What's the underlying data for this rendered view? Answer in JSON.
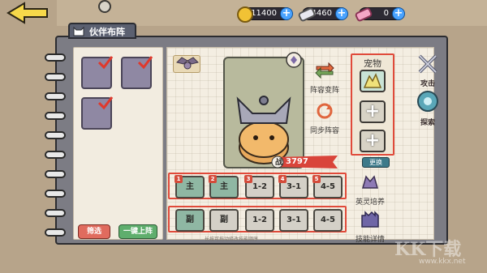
{
  "header": {
    "currencies": [
      {
        "icon": "gold-coin-icon",
        "value": "11400"
      },
      {
        "icon": "ticket-icon",
        "value": "34460"
      },
      {
        "icon": "pink-ticket-icon",
        "value": "0"
      }
    ]
  },
  "panel": {
    "title": "伙伴布阵"
  },
  "roster": {
    "filter_label": "筛选",
    "auto_label": "一键上阵"
  },
  "character": {
    "power_label": "战",
    "power_value": "3797"
  },
  "actions": {
    "formation_change": "阵容变阵",
    "sync_formation": "同步阵容",
    "hero_cultivate": "英灵培养",
    "skill_detail": "技能详情",
    "replace": "更换"
  },
  "formation": {
    "main_row": [
      {
        "num": "1",
        "label": "主",
        "filled": true
      },
      {
        "num": "2",
        "label": "主",
        "filled": true
      },
      {
        "num": "3",
        "label": "1-2",
        "filled": false
      },
      {
        "num": "4",
        "label": "3-1",
        "filled": false
      },
      {
        "num": "5",
        "label": "4-5",
        "filled": false
      }
    ],
    "sub_row": [
      {
        "label": "副",
        "filled": true
      },
      {
        "label": "副",
        "filled": false
      },
      {
        "label": "1-2",
        "filled": false
      },
      {
        "label": "3-1",
        "filled": false
      },
      {
        "label": "4-5",
        "filled": false
      }
    ],
    "hint": "长按可拖动修改技能顺序"
  },
  "pet": {
    "title": "宠物"
  },
  "right_tabs": {
    "attack": "攻击",
    "explore": "探索"
  },
  "watermark": {
    "text": "KK下载",
    "url": "www.kkx.net"
  },
  "colors": {
    "frame_red": "#e04a3a",
    "panel_gray": "#7c7c84",
    "paper": "#f4eee2"
  }
}
